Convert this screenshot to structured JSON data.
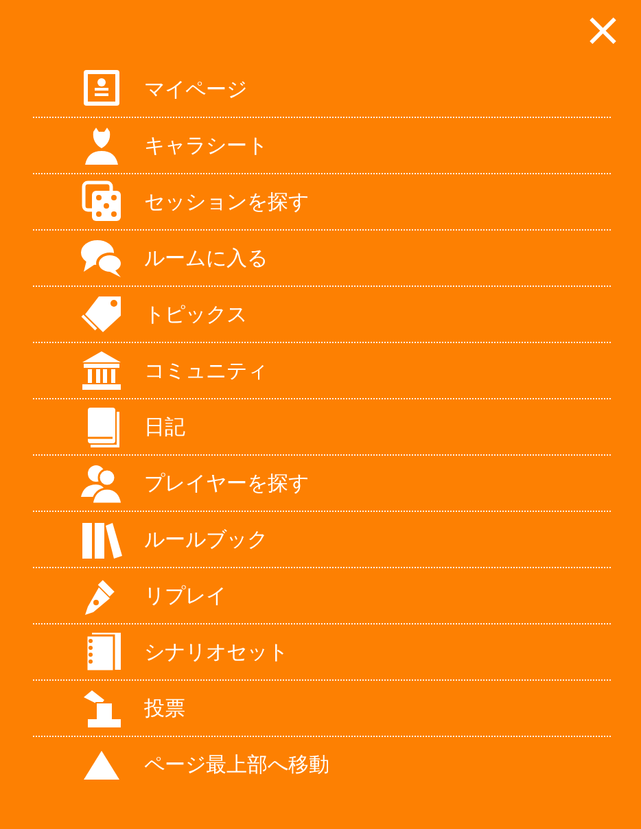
{
  "close_button": {
    "label": "×"
  },
  "menu": [
    {
      "label": "マイページ",
      "kind": "profile"
    },
    {
      "label": "キャラシート",
      "kind": "character"
    },
    {
      "label": "セッションを探す",
      "kind": "dice"
    },
    {
      "label": "ルームに入る",
      "kind": "chat"
    },
    {
      "label": "トピックス",
      "kind": "tag"
    },
    {
      "label": "コミュニティ",
      "kind": "building"
    },
    {
      "label": "日記",
      "kind": "book"
    },
    {
      "label": "プレイヤーを探す",
      "kind": "people"
    },
    {
      "label": "ルールブック",
      "kind": "books"
    },
    {
      "label": "リプレイ",
      "kind": "pen"
    },
    {
      "label": "シナリオセット",
      "kind": "notebook"
    },
    {
      "label": "投票",
      "kind": "vote"
    },
    {
      "label": "ページ最上部へ移動",
      "kind": "top"
    }
  ]
}
